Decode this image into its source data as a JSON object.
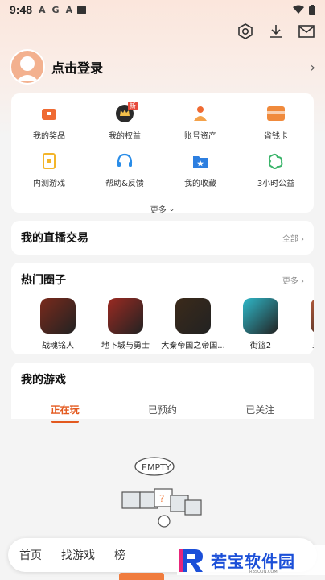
{
  "status": {
    "time": "9:48",
    "letters": [
      "A",
      "G",
      "A"
    ]
  },
  "user": {
    "login": "点击登录"
  },
  "grid": [
    {
      "label": "我的奖品",
      "icon": "gift-box-icon"
    },
    {
      "label": "我的权益",
      "icon": "crown-icon",
      "badge": "新"
    },
    {
      "label": "账号资产",
      "icon": "account-assets-icon"
    },
    {
      "label": "省钱卡",
      "icon": "savings-card-icon"
    },
    {
      "label": "内测游戏",
      "icon": "beta-game-icon"
    },
    {
      "label": "帮助&反馈",
      "icon": "headset-icon"
    },
    {
      "label": "我的收藏",
      "icon": "favorites-folder-icon"
    },
    {
      "label": "3小时公益",
      "icon": "charity-icon"
    }
  ],
  "more": "更多",
  "live": {
    "title": "我的直播交易",
    "action": "全部"
  },
  "circles": {
    "title": "热门圈子",
    "action": "更多",
    "items": [
      {
        "name": "战魂铭人",
        "color": "#7a2a1c"
      },
      {
        "name": "地下城与勇士",
        "color": "#9b2a22"
      },
      {
        "name": "大秦帝国之帝国...",
        "color": "#3b2a1a"
      },
      {
        "name": "街篮2",
        "color": "#2fb8c9"
      },
      {
        "name": "三国志幻",
        "color": "#b45a3a"
      }
    ]
  },
  "games": {
    "title": "我的游戏",
    "tabs": [
      "正在玩",
      "已预约",
      "已关注"
    ],
    "empty": "EMPTY"
  },
  "nav": [
    "首页",
    "找游戏",
    "榜"
  ],
  "watermark": {
    "text": "若宝软件园",
    "sub": "RBSOUN.COM"
  },
  "colors": {
    "accent": "#e3591e",
    "brand": "#1b4fd8"
  }
}
